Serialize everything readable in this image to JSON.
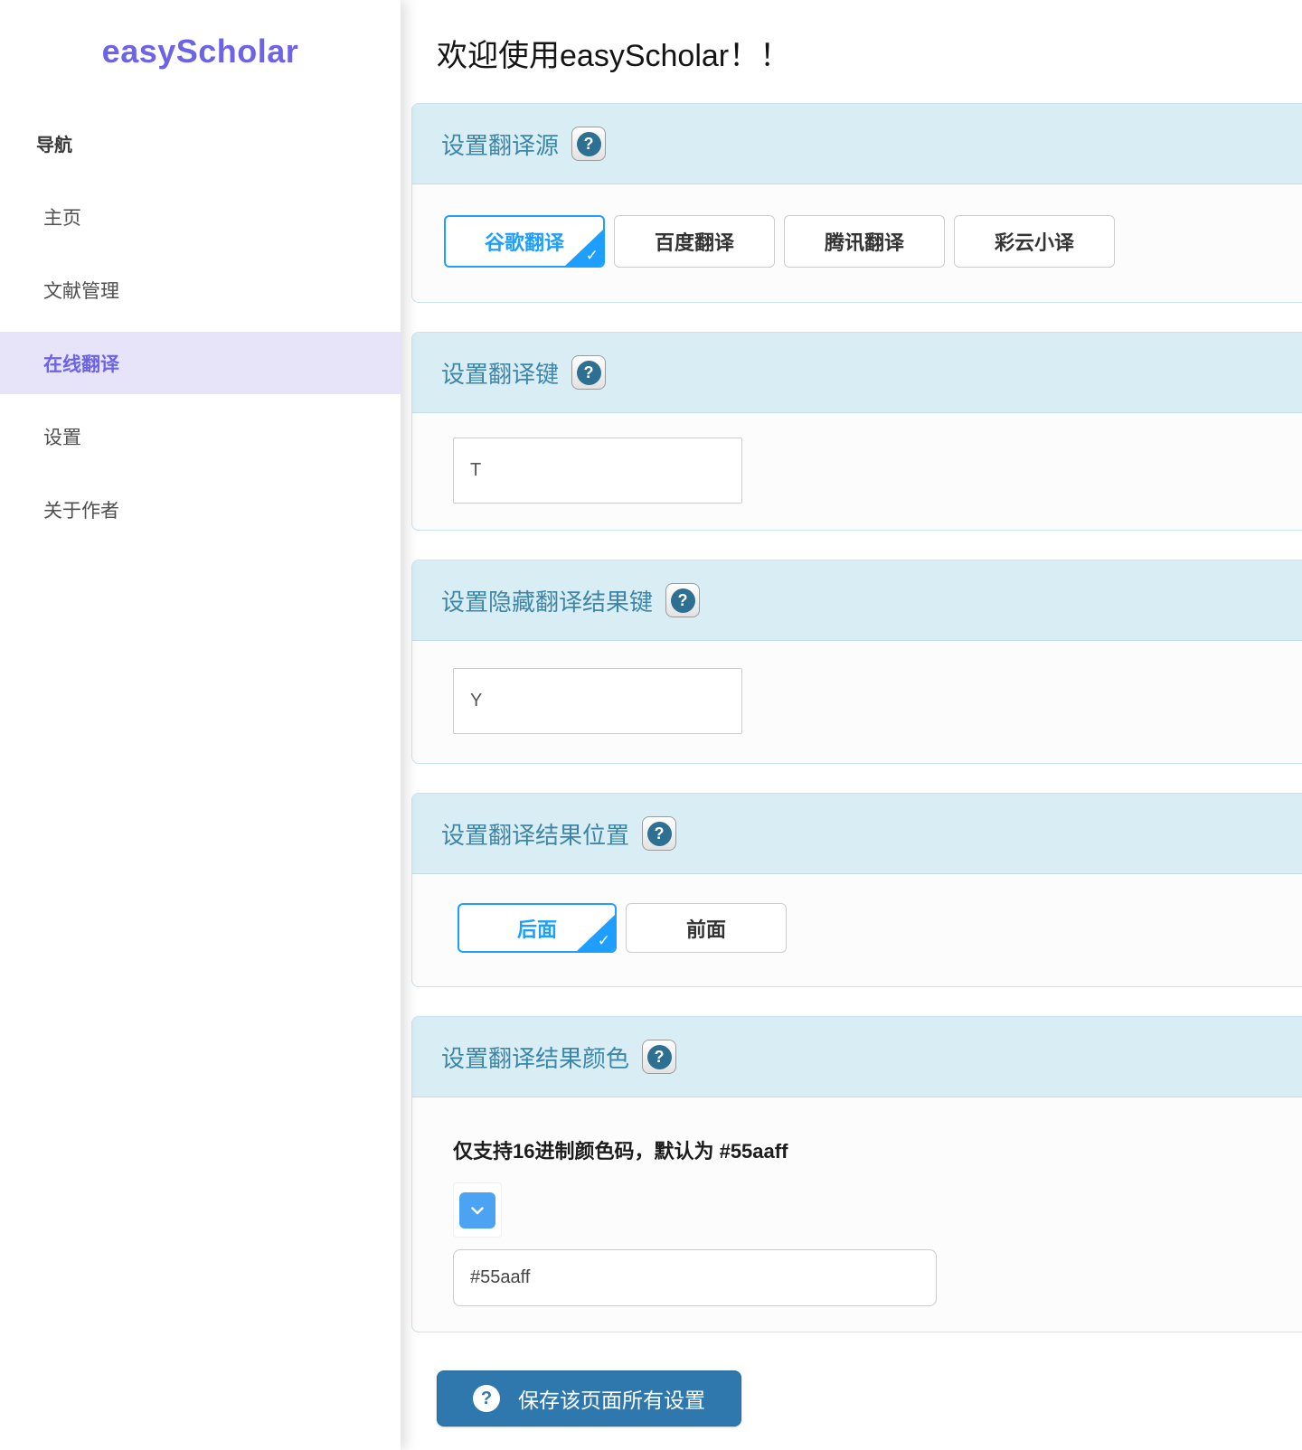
{
  "sidebar": {
    "logo": "easyScholar",
    "nav_heading": "导航",
    "items": [
      {
        "label": "主页",
        "active": false
      },
      {
        "label": "文献管理",
        "active": false
      },
      {
        "label": "在线翻译",
        "active": true
      },
      {
        "label": "设置",
        "active": false
      },
      {
        "label": "关于作者",
        "active": false
      }
    ]
  },
  "header": {
    "title": "欢迎使用easyScholar！！"
  },
  "icons": {
    "question": "?",
    "check": "✓"
  },
  "colors": {
    "brand_purple": "#6c63e8",
    "accent_blue": "#1e9fff",
    "save_button_blue": "#2f78ad",
    "default_result_color": "#55aaff"
  },
  "sections": {
    "source": {
      "title": "设置翻译源",
      "options": [
        {
          "label": "谷歌翻译",
          "selected": true
        },
        {
          "label": "百度翻译",
          "selected": false
        },
        {
          "label": "腾讯翻译",
          "selected": false
        },
        {
          "label": "彩云小译",
          "selected": false
        }
      ]
    },
    "translate_key": {
      "title": "设置翻译键",
      "value": "T"
    },
    "hide_key": {
      "title": "设置隐藏翻译结果键",
      "value": "Y"
    },
    "position": {
      "title": "设置翻译结果位置",
      "options": [
        {
          "label": "后面",
          "selected": true
        },
        {
          "label": "前面",
          "selected": false
        }
      ]
    },
    "color": {
      "title": "设置翻译结果颜色",
      "note": "仅支持16进制颜色码，默认为 #55aaff",
      "value": "#55aaff"
    }
  },
  "save_button": {
    "label": "保存该页面所有设置"
  }
}
